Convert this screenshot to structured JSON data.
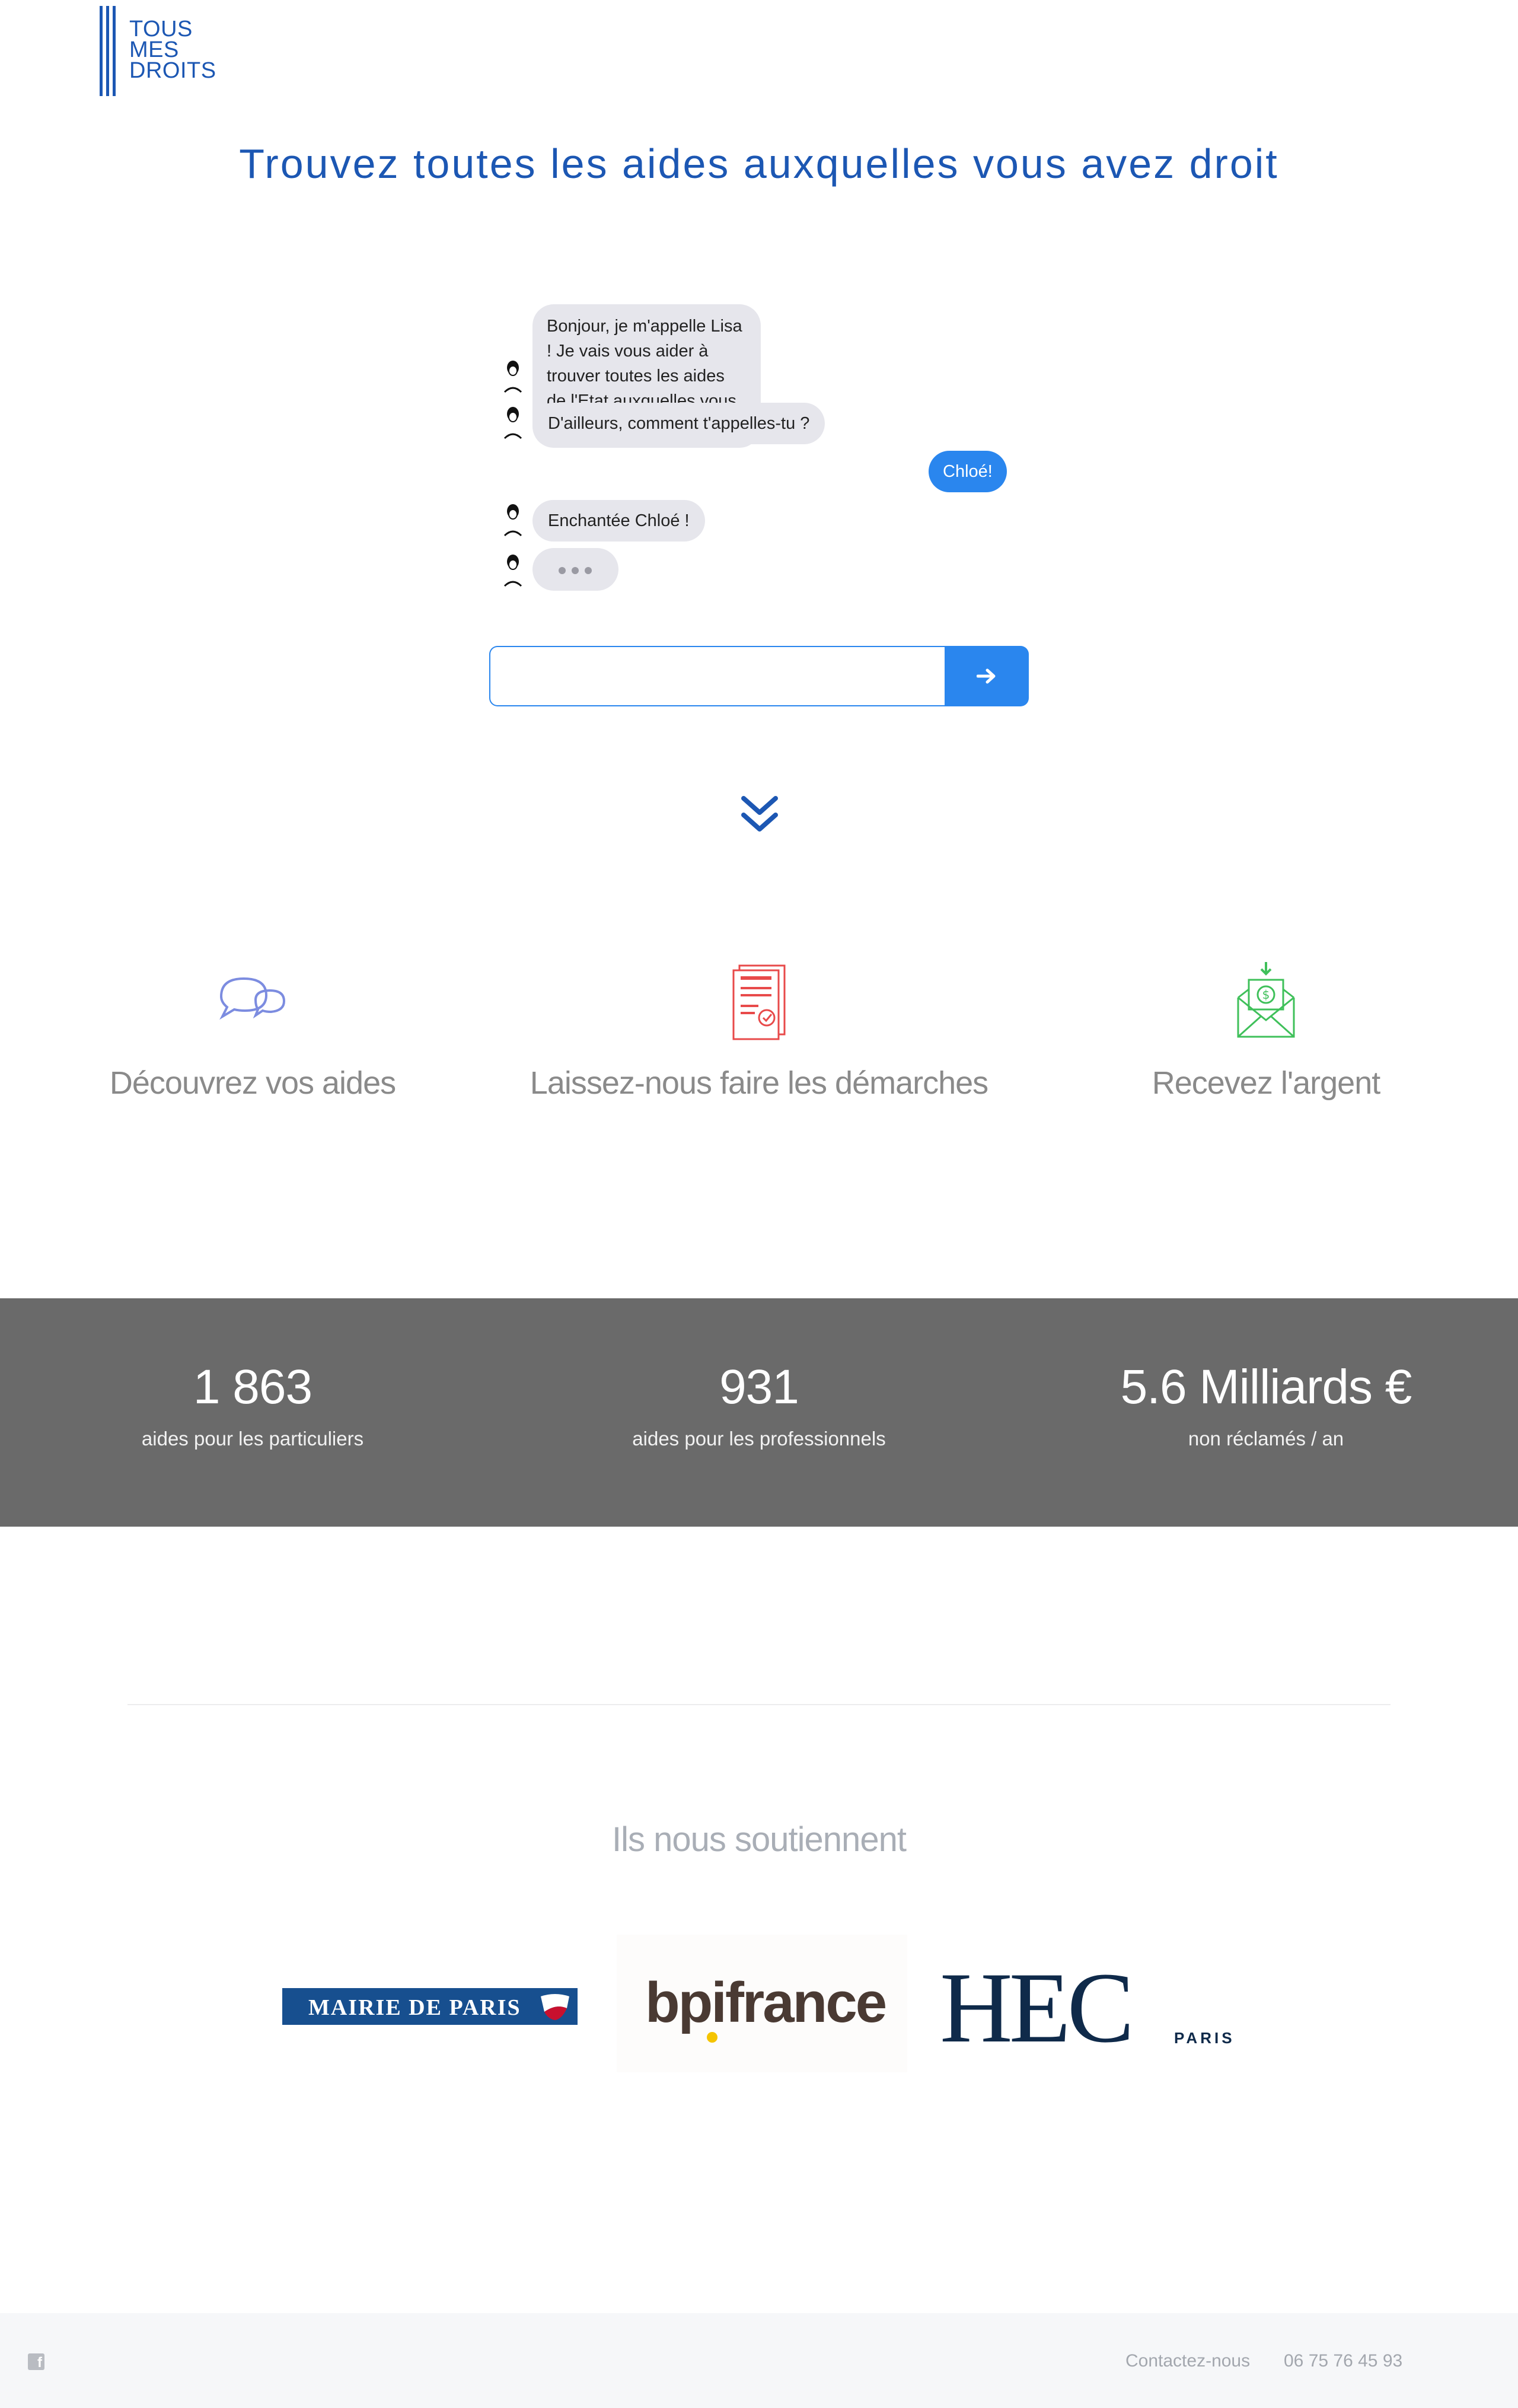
{
  "logo": {
    "lines": [
      "TOUS",
      "MES",
      "DROITS"
    ],
    "color": "#1c57b3"
  },
  "headline": "Trouvez toutes les aides auxquelles vous avez droit",
  "chat": {
    "messages": [
      {
        "from": "bot",
        "text": "Bonjour, je m'appelle Lisa ! Je vais vous aider à trouver toutes les aides de l'Etat auxquelles vous avez droit"
      },
      {
        "from": "bot",
        "text": "D'ailleurs, comment t'appelles-tu ?"
      },
      {
        "from": "user",
        "text": "Chloé!"
      },
      {
        "from": "bot",
        "text": "Enchantée Chloé !"
      }
    ],
    "input_value": "",
    "send_icon": "arrow-right-icon"
  },
  "steps": [
    {
      "label": "Découvrez vos aides",
      "icon": "chat-bubbles-icon",
      "color": "#7c8ce0"
    },
    {
      "label": "Laissez-nous faire les démarches",
      "icon": "document-check-icon",
      "color": "#e84a4a"
    },
    {
      "label": "Recevez l'argent",
      "icon": "money-envelope-icon",
      "color": "#3fc05a"
    }
  ],
  "stats": [
    {
      "value": "1 863",
      "label": "aides pour les particuliers"
    },
    {
      "value": "931",
      "label": "aides pour les professionnels"
    },
    {
      "value": "5.6 Milliards €",
      "label": "non réclamés / an"
    }
  ],
  "supporters": {
    "title": "Ils nous soutiennent",
    "logos": [
      {
        "name": "MAIRIE DE PARIS"
      },
      {
        "name": "bpifrance"
      },
      {
        "name": "HEC",
        "sub": "PARIS"
      }
    ]
  },
  "footer": {
    "social_icon": "facebook-icon",
    "contact": "Contactez-nous",
    "phone": "06 75 76 45 93"
  },
  "colors": {
    "accent": "#2a86ee",
    "brand": "#1c57b3",
    "stats_bg": "#6a6a6a",
    "bubble_bg": "#e6e6ec"
  }
}
